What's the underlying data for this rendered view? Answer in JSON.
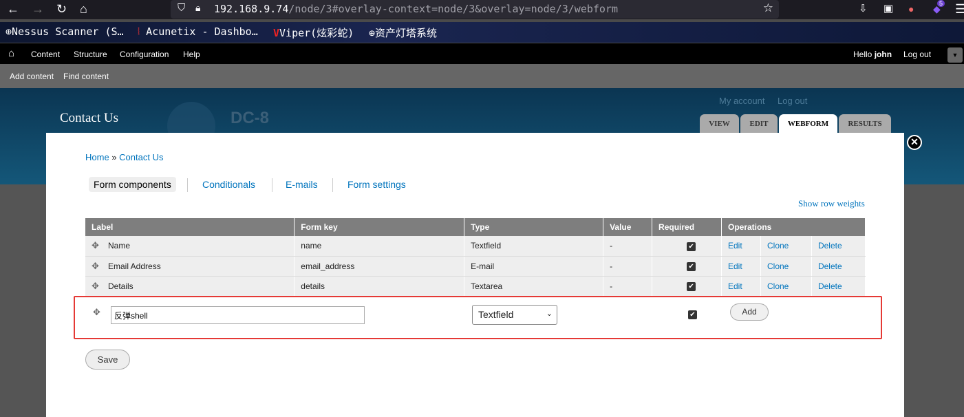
{
  "browser": {
    "url_host": "192.168.9.74",
    "url_rest": "/node/3#overlay-context=node/3&overlay=node/3/webform",
    "badge_count": "5",
    "bookmarks": [
      "Nessus Scanner (S…",
      "Acunetix - Dashbo…",
      "Viper(炫彩蛇)",
      "资产灯塔系统"
    ]
  },
  "admin_menu": {
    "items": [
      "Content",
      "Structure",
      "Configuration",
      "Help"
    ],
    "hello": "Hello",
    "user": "john",
    "logout": "Log out"
  },
  "shortcuts": [
    "Add content",
    "Find content"
  ],
  "header": {
    "site_title": "Contact Us",
    "slogan": "DC-8",
    "secondary": [
      "My account",
      "Log out"
    ],
    "tabs": [
      "VIEW",
      "EDIT",
      "WEBFORM",
      "RESULTS"
    ]
  },
  "breadcrumb": {
    "home": "Home",
    "sep": "»",
    "current": "Contact Us"
  },
  "subtabs": [
    "Form components",
    "Conditionals",
    "E-mails",
    "Form settings"
  ],
  "show_weights": "Show row weights",
  "table": {
    "headers": [
      "Label",
      "Form key",
      "Type",
      "Value",
      "Required",
      "Operations"
    ],
    "rows": [
      {
        "label": "Name",
        "key": "name",
        "type": "Textfield",
        "value": "-"
      },
      {
        "label": "Email Address",
        "key": "email_address",
        "type": "E-mail",
        "value": "-"
      },
      {
        "label": "Details",
        "key": "details",
        "type": "Textarea",
        "value": "-"
      }
    ],
    "ops": [
      "Edit",
      "Clone",
      "Delete"
    ]
  },
  "new_component": {
    "label_value": "反弹shell",
    "type_value": "Textfield",
    "add_label": "Add"
  },
  "save_label": "Save"
}
